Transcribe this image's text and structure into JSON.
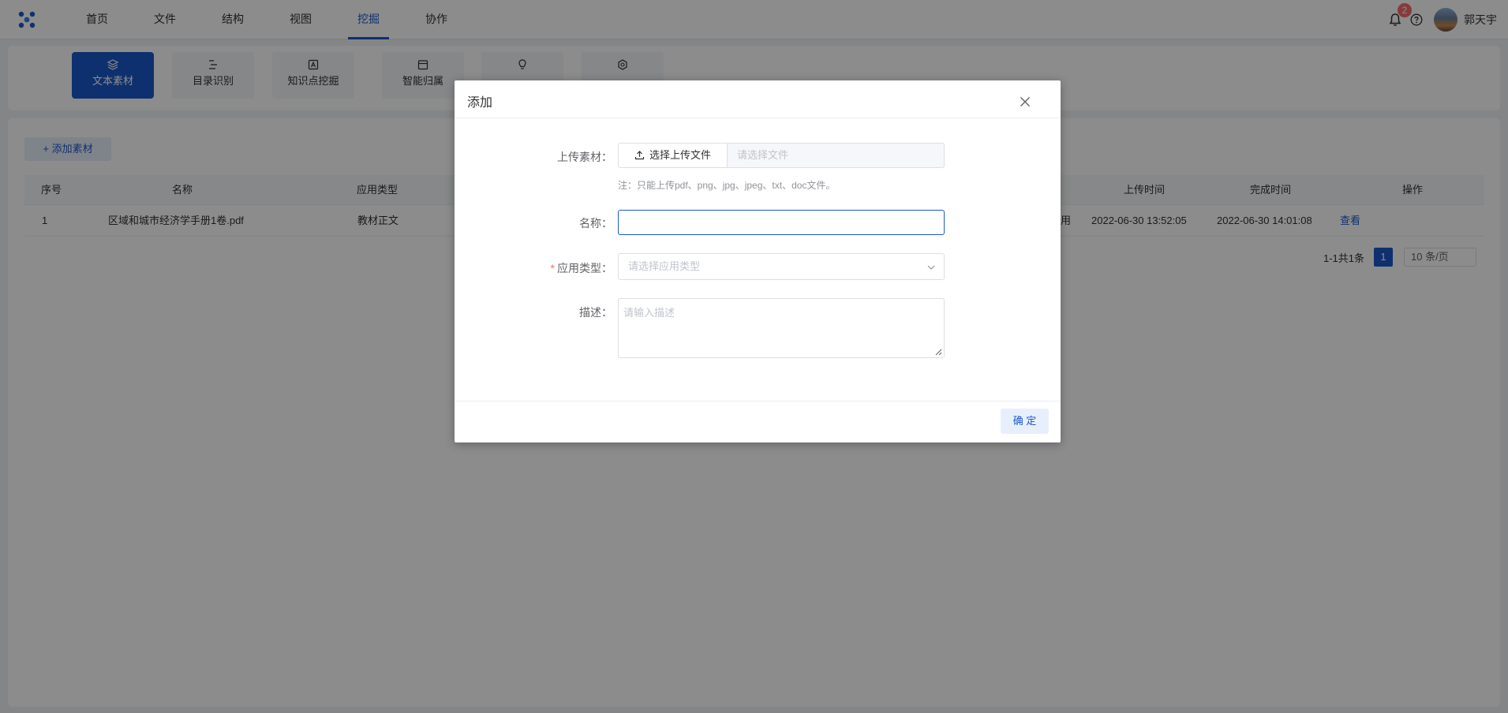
{
  "nav": {
    "items": [
      "首页",
      "文件",
      "结构",
      "视图",
      "挖掘",
      "协作"
    ],
    "active_index": 4
  },
  "header": {
    "notification_count": "2",
    "username": "郭天宇"
  },
  "toolbar": {
    "tools": [
      {
        "label": "文本素材",
        "icon": "layers-icon",
        "active": true
      },
      {
        "label": "目录识别",
        "icon": "list-icon",
        "active": false
      },
      {
        "label": "知识点挖掘",
        "icon": "knowledge-icon",
        "active": false
      },
      {
        "label": "智能归属",
        "icon": "calendar-icon",
        "active": false
      },
      {
        "label": "",
        "icon": "bulb-icon",
        "active": false
      },
      {
        "label": "",
        "icon": "cluster-icon",
        "active": false
      }
    ]
  },
  "main": {
    "add_button": "+ 添加素材",
    "columns": {
      "index": "序号",
      "name": "名称",
      "app_type": "应用类型",
      "upload_time": "上传时间",
      "finish_time": "完成时间",
      "actions": "操作"
    },
    "rows": [
      {
        "index": "1",
        "name": "区域和城市经济学手册1卷.pdf",
        "app_type": "教材正文",
        "partial_status": "用",
        "upload_time": "2022-06-30 13:52:05",
        "finish_time": "2022-06-30 14:01:08",
        "action": "查看"
      }
    ],
    "pagination": {
      "total": "1-1共1条",
      "current_page": "1",
      "page_size": "10 条/页"
    }
  },
  "dialog": {
    "title": "添加",
    "upload_label": "上传素材：",
    "upload_button": "选择上传文件",
    "upload_placeholder": "请选择文件",
    "upload_note": "注：只能上传pdf、png、jpg、jpeg、txt、doc文件。",
    "name_label": "名称：",
    "name_value": "",
    "app_type_required": "*",
    "app_type_label": "应用类型：",
    "app_type_placeholder": "请选择应用类型",
    "desc_label": "描述：",
    "desc_placeholder": "请输入描述",
    "confirm_button": "确 定"
  },
  "colors": {
    "accent": "#1d58c9",
    "badge": "#f56c6c"
  }
}
